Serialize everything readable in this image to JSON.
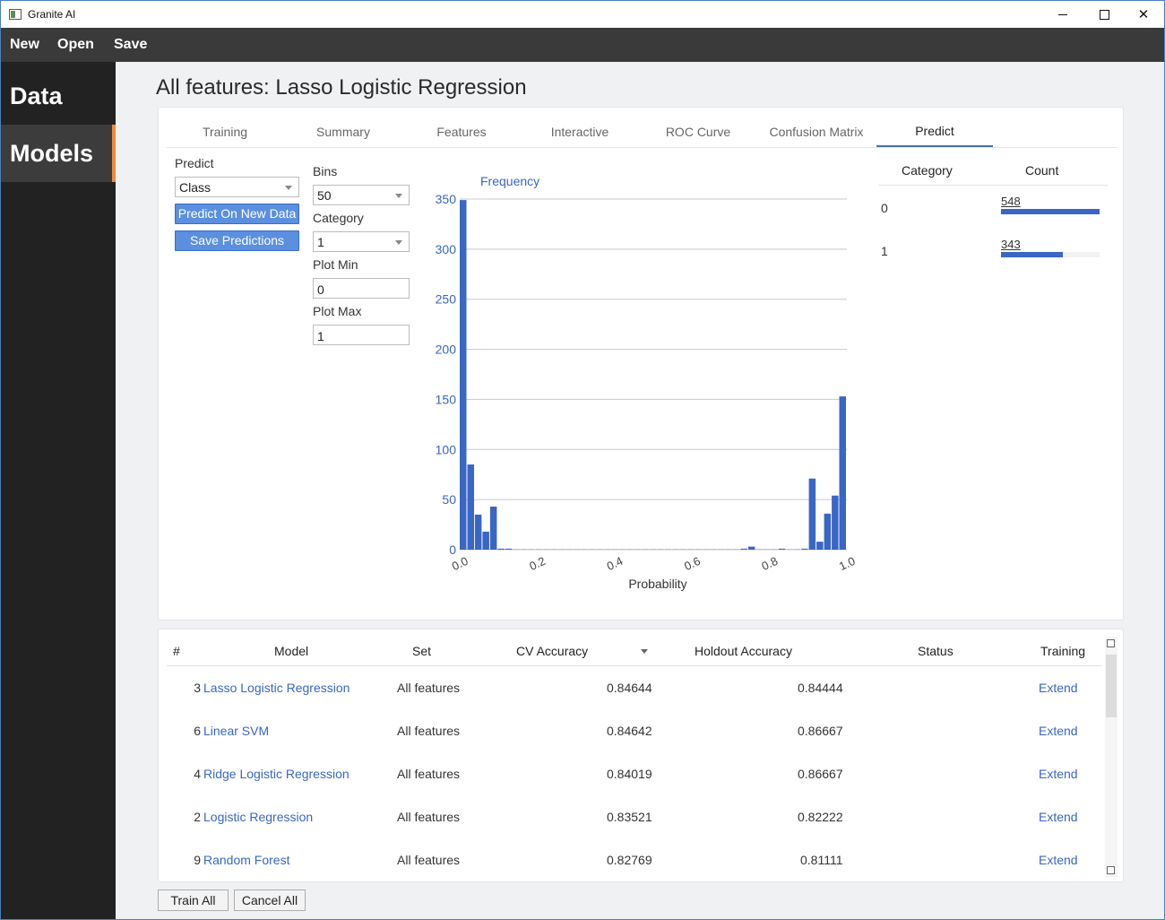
{
  "window": {
    "title": "Granite AI"
  },
  "menubar": {
    "new": "New",
    "open": "Open",
    "save": "Save"
  },
  "sidebar": {
    "items": [
      {
        "label": "Data"
      },
      {
        "label": "Models"
      }
    ],
    "accent": "#f08a3c"
  },
  "page": {
    "title": "All features: Lasso Logistic Regression"
  },
  "tabs": [
    {
      "label": "Training"
    },
    {
      "label": "Summary"
    },
    {
      "label": "Features"
    },
    {
      "label": "Interactive"
    },
    {
      "label": "ROC Curve"
    },
    {
      "label": "Confusion Matrix"
    },
    {
      "label": "Predict"
    }
  ],
  "predict_panel": {
    "predict_label": "Predict",
    "predict_value": "Class",
    "predict_new_button": "Predict On New Data",
    "save_predictions_button": "Save Predictions",
    "bins_label": "Bins",
    "bins_value": "50",
    "category_label": "Category",
    "category_value": "1",
    "plot_min_label": "Plot Min",
    "plot_min_value": "0",
    "plot_max_label": "Plot Max",
    "plot_max_value": "1"
  },
  "chart_data": {
    "type": "bar",
    "title": "Frequency",
    "xlabel": "Probability",
    "ylabel": "",
    "xlim": [
      0,
      1
    ],
    "ylim": [
      0,
      350
    ],
    "x_ticks": [
      "0.0",
      "0.2",
      "0.4",
      "0.6",
      "0.8",
      "1.0"
    ],
    "y_ticks": [
      "0",
      "50",
      "100",
      "150",
      "200",
      "250",
      "300",
      "350"
    ],
    "bin_width": 0.02,
    "values": [
      349,
      85,
      35,
      18,
      43,
      1,
      1,
      0,
      0,
      0,
      0,
      0,
      0,
      0,
      0,
      0,
      0,
      0,
      0,
      0,
      0,
      0,
      0,
      0,
      0,
      0,
      0,
      0,
      0,
      0,
      0,
      0,
      0,
      0,
      0,
      0,
      0,
      1,
      3,
      0,
      0,
      0,
      1,
      0,
      0,
      1,
      71,
      8,
      36,
      54,
      153
    ],
    "grid": true,
    "bar_color": "#3a66c4"
  },
  "counts": {
    "header_category": "Category",
    "header_count": "Count",
    "rows": [
      {
        "category": "0",
        "count": "548",
        "fraction": 1.0
      },
      {
        "category": "1",
        "count": "343",
        "fraction": 0.626
      }
    ]
  },
  "models_table": {
    "headers": {
      "num": "#",
      "model": "Model",
      "set": "Set",
      "cv": "CV Accuracy",
      "holdout": "Holdout Accuracy",
      "status": "Status",
      "training": "Training"
    },
    "rows": [
      {
        "num": "3",
        "model": "Lasso Logistic Regression",
        "set": "All features",
        "cv": "0.84644",
        "holdout": "0.84444",
        "status": "",
        "training": "Extend"
      },
      {
        "num": "6",
        "model": "Linear SVM",
        "set": "All features",
        "cv": "0.84642",
        "holdout": "0.86667",
        "status": "",
        "training": "Extend"
      },
      {
        "num": "4",
        "model": "Ridge Logistic Regression",
        "set": "All features",
        "cv": "0.84019",
        "holdout": "0.86667",
        "status": "",
        "training": "Extend"
      },
      {
        "num": "2",
        "model": "Logistic Regression",
        "set": "All features",
        "cv": "0.83521",
        "holdout": "0.82222",
        "status": "",
        "training": "Extend"
      },
      {
        "num": "9",
        "model": "Random Forest",
        "set": "All features",
        "cv": "0.82769",
        "holdout": "0.81111",
        "status": "",
        "training": "Extend"
      }
    ]
  },
  "footer": {
    "train_all": "Train All",
    "cancel_all": "Cancel All"
  }
}
